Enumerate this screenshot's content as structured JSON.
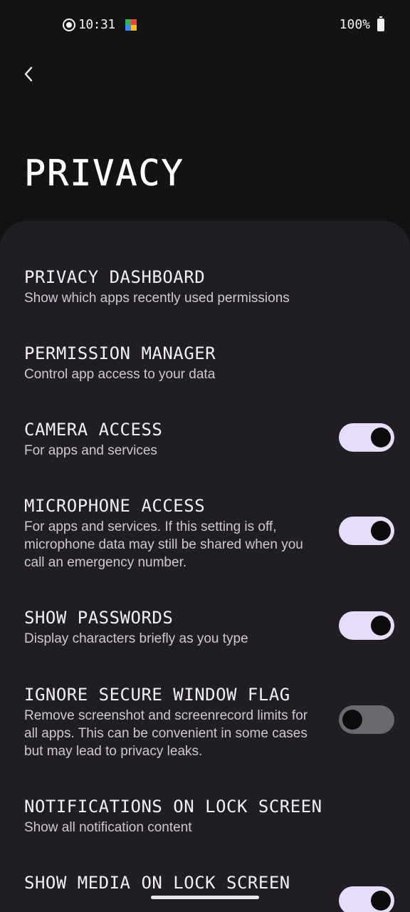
{
  "status_bar": {
    "time": "10:31",
    "battery": "100%",
    "icons": [
      "screen-record-icon",
      "play-store-icon",
      "battery-icon"
    ]
  },
  "header": {
    "back_icon": "chevron-left-icon",
    "title": "PRIVACY"
  },
  "settings": [
    {
      "title": "PRIVACY DASHBOARD",
      "subtitle": "Show which apps recently used permissions",
      "toggle": null
    },
    {
      "title": "PERMISSION MANAGER",
      "subtitle": "Control app access to your data",
      "toggle": null
    },
    {
      "title": "CAMERA ACCESS",
      "subtitle": "For apps and services",
      "toggle": "on"
    },
    {
      "title": "MICROPHONE ACCESS",
      "subtitle": "For apps and services. If this setting is off, microphone data may still be shared when you call an emergency number.",
      "toggle": "on"
    },
    {
      "title": "SHOW PASSWORDS",
      "subtitle": "Display characters briefly as you type",
      "toggle": "on"
    },
    {
      "title": "IGNORE SECURE WINDOW FLAG",
      "subtitle": "Remove screenshot and screenrecord limits for all apps. This can be convenient in some cases but may lead to privacy leaks.",
      "toggle": "off"
    },
    {
      "title": "NOTIFICATIONS ON LOCK SCREEN",
      "subtitle": "Show all notification content",
      "toggle": null
    },
    {
      "title": "SHOW MEDIA ON LOCK SCREEN",
      "subtitle": "",
      "toggle": "on"
    }
  ],
  "colors": {
    "background": "#131313",
    "card": "#201e24",
    "toggle_on": "#e8dcfb",
    "toggle_off": "#6b6870",
    "knob": "#0c0c0e"
  }
}
